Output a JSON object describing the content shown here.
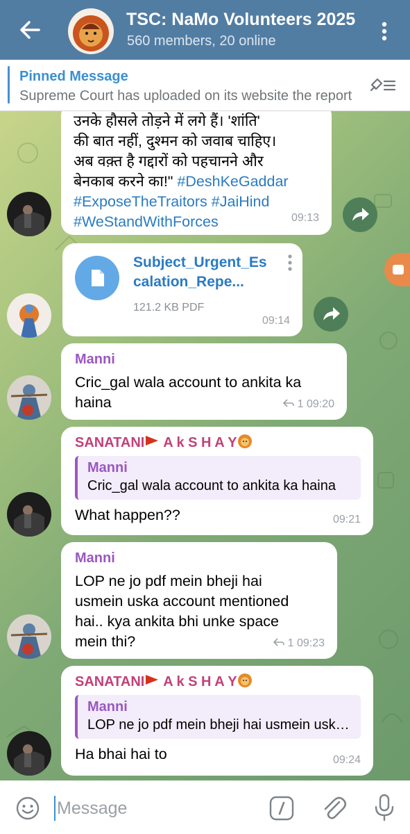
{
  "header": {
    "title": "TSC: NaMo Volunteers 2025",
    "subtitle": "560 members, 20 online"
  },
  "pinned": {
    "title": "Pinned Message",
    "text": "Supreme Court has uploaded on its website the report"
  },
  "messages": {
    "m1": {
      "lines": [
        "उनके हौसले तोड़ने में लगे हैं। 'शांति'",
        "की बात नहीं, दुश्मन को जवाब चाहिए।",
        "अब वक़्त है गद्दारों को पहचानने और",
        "बेनकाब करने का!\""
      ],
      "tags": [
        "#DeshKeGaddar",
        "#ExposeTheTraitors",
        "#JaiHind",
        "#WeStandWithForces"
      ],
      "time": "09:13"
    },
    "m2": {
      "file_name_1": "Subject_Urgent_Es",
      "file_name_2": "calation_Repe...",
      "file_info": "121.2 KB PDF",
      "time": "09:14"
    },
    "m3": {
      "sender": "Manni",
      "text_1": "Cric_gal wala account to ankita ka",
      "text_2": "haina",
      "replies": "1",
      "time": "09:20"
    },
    "m4": {
      "sender": "SANATANI",
      "sender_tail": "A k S H A Y",
      "quote_name": "Manni",
      "quote_text": "Cric_gal wala account to ankita ka haina",
      "text": "What happen??",
      "time": "09:21"
    },
    "m5": {
      "sender": "Manni",
      "lines": [
        "LOP ne jo pdf mein bheji hai",
        "usmein uska account mentioned",
        "hai.. kya ankita bhi unke space",
        "mein thi?"
      ],
      "replies": "1",
      "time": "09:23"
    },
    "m6": {
      "sender": "SANATANI",
      "sender_tail": "A k S H A Y",
      "quote_name": "Manni",
      "quote_text": "LOP ne jo pdf mein bheji hai usmein uska account",
      "text": "Ha bhai hai to",
      "time": "09:24"
    }
  },
  "input": {
    "placeholder": "Message"
  },
  "colors": {
    "header_bg": "#527da3",
    "link": "#2a7bc2",
    "sender_manni": "#9a57c2",
    "sender_sanatani": "#c2417a"
  }
}
